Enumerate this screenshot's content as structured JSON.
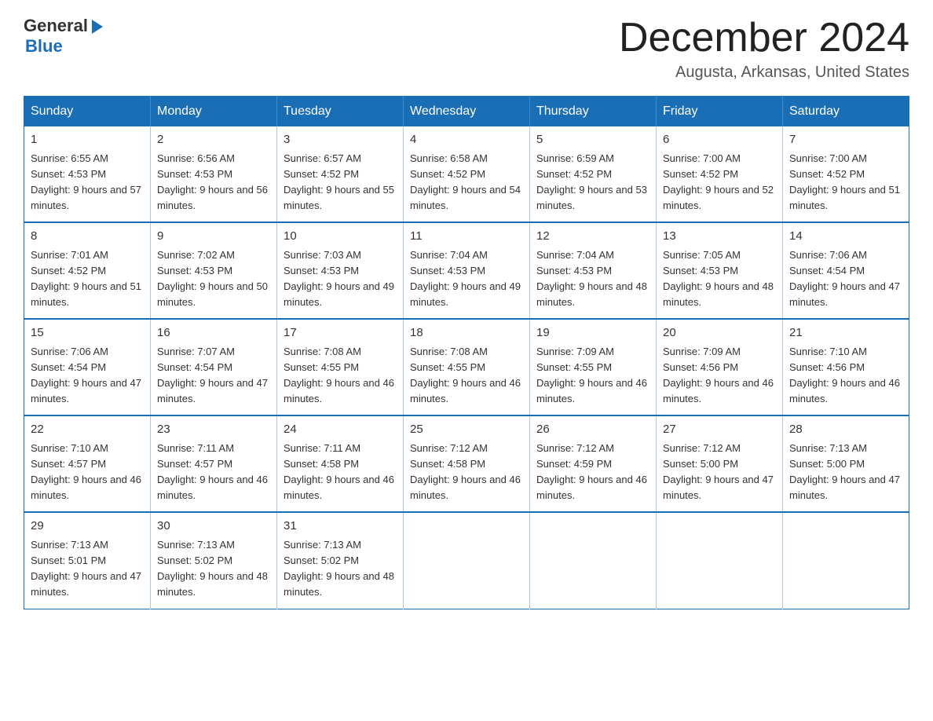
{
  "logo": {
    "general": "General",
    "blue": "Blue"
  },
  "title": "December 2024",
  "location": "Augusta, Arkansas, United States",
  "weekdays": [
    "Sunday",
    "Monday",
    "Tuesday",
    "Wednesday",
    "Thursday",
    "Friday",
    "Saturday"
  ],
  "weeks": [
    [
      {
        "day": "1",
        "sunrise": "6:55 AM",
        "sunset": "4:53 PM",
        "daylight": "9 hours and 57 minutes."
      },
      {
        "day": "2",
        "sunrise": "6:56 AM",
        "sunset": "4:53 PM",
        "daylight": "9 hours and 56 minutes."
      },
      {
        "day": "3",
        "sunrise": "6:57 AM",
        "sunset": "4:52 PM",
        "daylight": "9 hours and 55 minutes."
      },
      {
        "day": "4",
        "sunrise": "6:58 AM",
        "sunset": "4:52 PM",
        "daylight": "9 hours and 54 minutes."
      },
      {
        "day": "5",
        "sunrise": "6:59 AM",
        "sunset": "4:52 PM",
        "daylight": "9 hours and 53 minutes."
      },
      {
        "day": "6",
        "sunrise": "7:00 AM",
        "sunset": "4:52 PM",
        "daylight": "9 hours and 52 minutes."
      },
      {
        "day": "7",
        "sunrise": "7:00 AM",
        "sunset": "4:52 PM",
        "daylight": "9 hours and 51 minutes."
      }
    ],
    [
      {
        "day": "8",
        "sunrise": "7:01 AM",
        "sunset": "4:52 PM",
        "daylight": "9 hours and 51 minutes."
      },
      {
        "day": "9",
        "sunrise": "7:02 AM",
        "sunset": "4:53 PM",
        "daylight": "9 hours and 50 minutes."
      },
      {
        "day": "10",
        "sunrise": "7:03 AM",
        "sunset": "4:53 PM",
        "daylight": "9 hours and 49 minutes."
      },
      {
        "day": "11",
        "sunrise": "7:04 AM",
        "sunset": "4:53 PM",
        "daylight": "9 hours and 49 minutes."
      },
      {
        "day": "12",
        "sunrise": "7:04 AM",
        "sunset": "4:53 PM",
        "daylight": "9 hours and 48 minutes."
      },
      {
        "day": "13",
        "sunrise": "7:05 AM",
        "sunset": "4:53 PM",
        "daylight": "9 hours and 48 minutes."
      },
      {
        "day": "14",
        "sunrise": "7:06 AM",
        "sunset": "4:54 PM",
        "daylight": "9 hours and 47 minutes."
      }
    ],
    [
      {
        "day": "15",
        "sunrise": "7:06 AM",
        "sunset": "4:54 PM",
        "daylight": "9 hours and 47 minutes."
      },
      {
        "day": "16",
        "sunrise": "7:07 AM",
        "sunset": "4:54 PM",
        "daylight": "9 hours and 47 minutes."
      },
      {
        "day": "17",
        "sunrise": "7:08 AM",
        "sunset": "4:55 PM",
        "daylight": "9 hours and 46 minutes."
      },
      {
        "day": "18",
        "sunrise": "7:08 AM",
        "sunset": "4:55 PM",
        "daylight": "9 hours and 46 minutes."
      },
      {
        "day": "19",
        "sunrise": "7:09 AM",
        "sunset": "4:55 PM",
        "daylight": "9 hours and 46 minutes."
      },
      {
        "day": "20",
        "sunrise": "7:09 AM",
        "sunset": "4:56 PM",
        "daylight": "9 hours and 46 minutes."
      },
      {
        "day": "21",
        "sunrise": "7:10 AM",
        "sunset": "4:56 PM",
        "daylight": "9 hours and 46 minutes."
      }
    ],
    [
      {
        "day": "22",
        "sunrise": "7:10 AM",
        "sunset": "4:57 PM",
        "daylight": "9 hours and 46 minutes."
      },
      {
        "day": "23",
        "sunrise": "7:11 AM",
        "sunset": "4:57 PM",
        "daylight": "9 hours and 46 minutes."
      },
      {
        "day": "24",
        "sunrise": "7:11 AM",
        "sunset": "4:58 PM",
        "daylight": "9 hours and 46 minutes."
      },
      {
        "day": "25",
        "sunrise": "7:12 AM",
        "sunset": "4:58 PM",
        "daylight": "9 hours and 46 minutes."
      },
      {
        "day": "26",
        "sunrise": "7:12 AM",
        "sunset": "4:59 PM",
        "daylight": "9 hours and 46 minutes."
      },
      {
        "day": "27",
        "sunrise": "7:12 AM",
        "sunset": "5:00 PM",
        "daylight": "9 hours and 47 minutes."
      },
      {
        "day": "28",
        "sunrise": "7:13 AM",
        "sunset": "5:00 PM",
        "daylight": "9 hours and 47 minutes."
      }
    ],
    [
      {
        "day": "29",
        "sunrise": "7:13 AM",
        "sunset": "5:01 PM",
        "daylight": "9 hours and 47 minutes."
      },
      {
        "day": "30",
        "sunrise": "7:13 AM",
        "sunset": "5:02 PM",
        "daylight": "9 hours and 48 minutes."
      },
      {
        "day": "31",
        "sunrise": "7:13 AM",
        "sunset": "5:02 PM",
        "daylight": "9 hours and 48 minutes."
      },
      null,
      null,
      null,
      null
    ]
  ]
}
